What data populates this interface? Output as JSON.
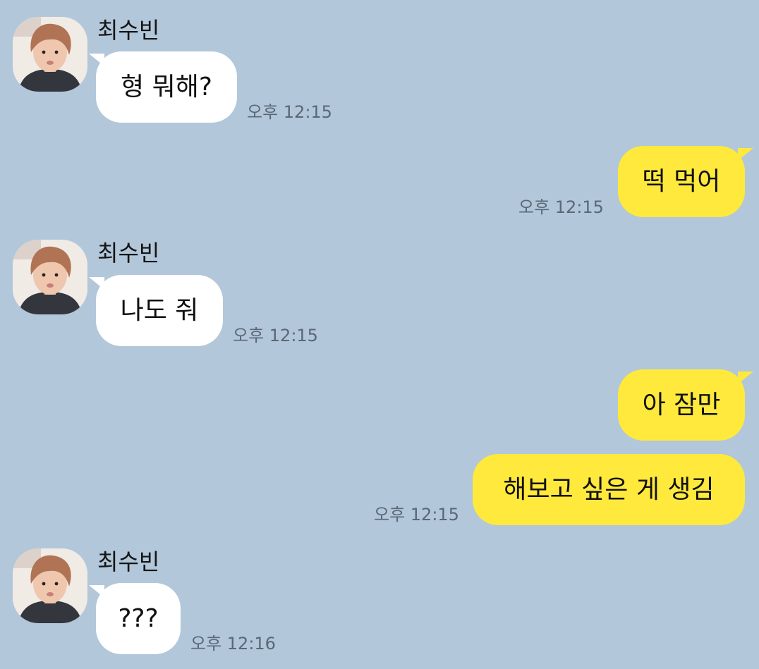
{
  "chat": {
    "colors": {
      "background": "#b2c7da",
      "incoming_bubble": "#ffffff",
      "outgoing_bubble": "#fee93c",
      "timestamp": "#5b6775"
    },
    "messages": [
      {
        "direction": "incoming",
        "sender": "최수빈",
        "avatar_icon": "profile-photo",
        "text": "형 뭐해?",
        "time": "오후 12:15"
      },
      {
        "direction": "outgoing",
        "text": "떡 먹어",
        "time": "오후 12:15"
      },
      {
        "direction": "incoming",
        "sender": "최수빈",
        "avatar_icon": "profile-photo",
        "text": "나도 줘",
        "time": "오후 12:15"
      },
      {
        "direction": "outgoing",
        "text": "아 잠만",
        "time": ""
      },
      {
        "direction": "outgoing",
        "text": "해보고 싶은 게 생김",
        "time": "오후 12:15"
      },
      {
        "direction": "incoming",
        "sender": "최수빈",
        "avatar_icon": "profile-photo",
        "text": "???",
        "time": "오후 12:16"
      }
    ]
  }
}
